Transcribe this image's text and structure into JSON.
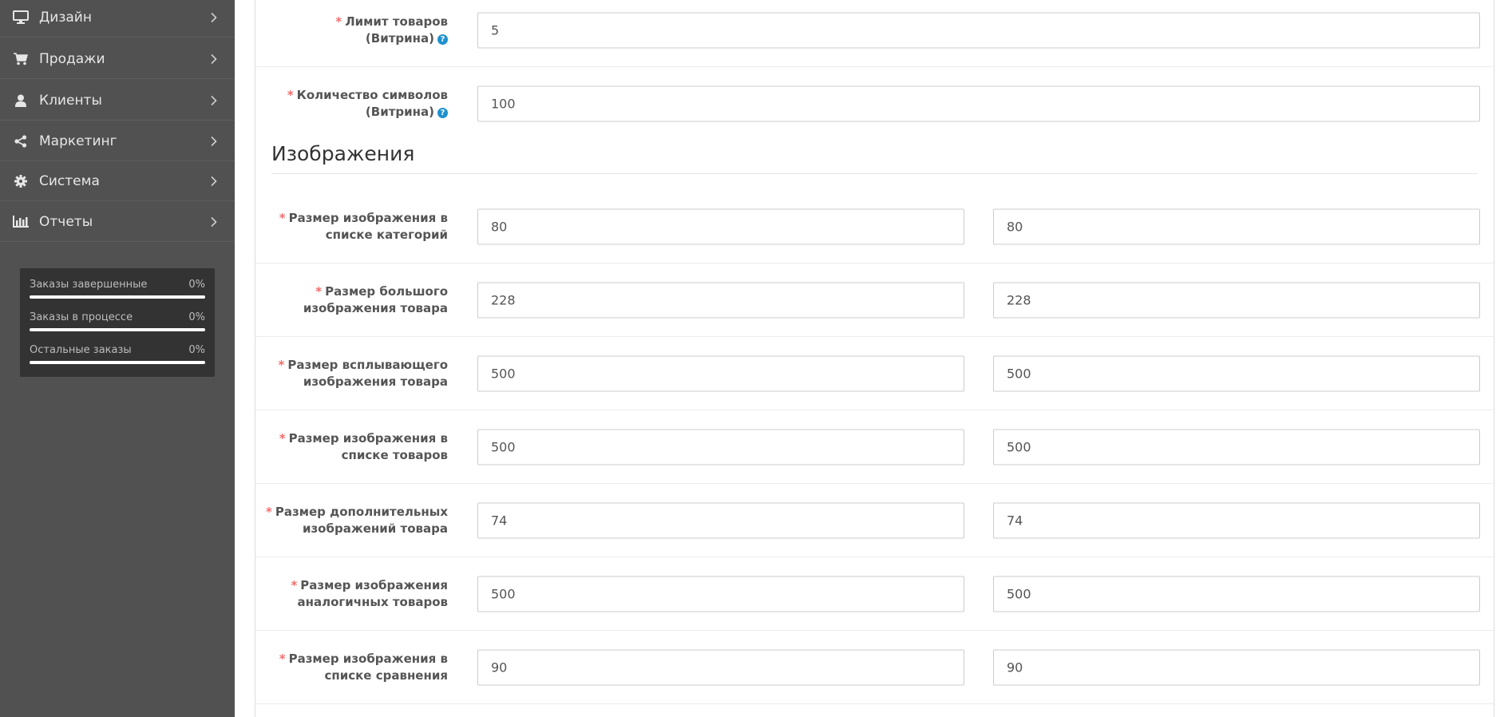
{
  "sidebar": {
    "items": [
      {
        "label": "Дизайн",
        "icon": "desktop-icon"
      },
      {
        "label": "Продажи",
        "icon": "shopping-cart-icon"
      },
      {
        "label": "Клиенты",
        "icon": "user-icon"
      },
      {
        "label": "Маркетинг",
        "icon": "share-icon"
      },
      {
        "label": "Система",
        "icon": "gear-icon"
      },
      {
        "label": "Отчеты",
        "icon": "bar-chart-icon"
      }
    ],
    "stats": [
      {
        "label": "Заказы завершенные",
        "percent": "0%",
        "value": 0
      },
      {
        "label": "Заказы в процессе",
        "percent": "0%",
        "value": 0
      },
      {
        "label": "Остальные заказы",
        "percent": "0%",
        "value": 0
      }
    ]
  },
  "form": {
    "required_mark": "*",
    "help_glyph": "?",
    "store_fields": [
      {
        "label_line1": "Лимит товаров",
        "label_line2": "(Витрина)",
        "value": "5"
      },
      {
        "label_line1": "Количество символов",
        "label_line2": "(Витрина)",
        "value": "100"
      }
    ],
    "images_section_title": "Изображения",
    "image_fields": [
      {
        "label_line1": "Размер изображения в",
        "label_line2": "списке категорий",
        "width": "80",
        "height": "80"
      },
      {
        "label_line1": "Размер большого",
        "label_line2": "изображения товара",
        "width": "228",
        "height": "228"
      },
      {
        "label_line1": "Размер всплывающего",
        "label_line2": "изображения товара",
        "width": "500",
        "height": "500"
      },
      {
        "label_line1": "Размер изображения в",
        "label_line2": "списке товаров",
        "width": "500",
        "height": "500"
      },
      {
        "label_line1": "Размер дополнительных",
        "label_line2": "изображений товара",
        "width": "74",
        "height": "74"
      },
      {
        "label_line1": "Размер изображения",
        "label_line2": "аналогичных товаров",
        "width": "500",
        "height": "500"
      },
      {
        "label_line1": "Размер изображения в",
        "label_line2": "списке сравнения",
        "width": "90",
        "height": "90"
      }
    ]
  },
  "colors": {
    "sidebar_bg": "#515151",
    "stats_bg": "#333333",
    "required": "#f56b6b",
    "help": "#1e91cf"
  }
}
